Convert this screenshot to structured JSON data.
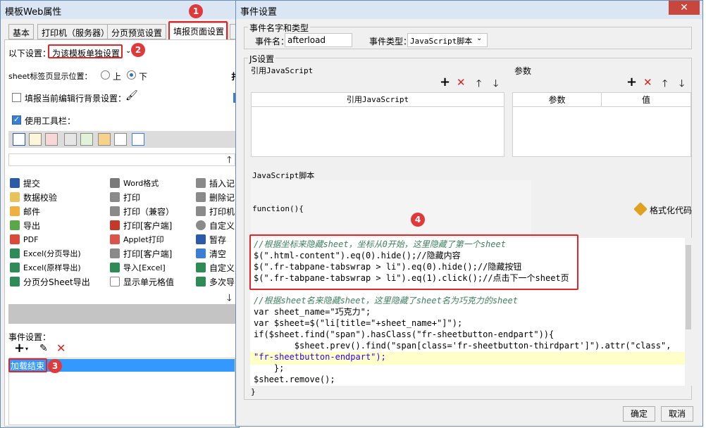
{
  "left_window": {
    "title": "模板Web属性",
    "tabs": [
      "基本",
      "打印机（服务器）",
      "分页预览设置",
      "填报页面设置"
    ],
    "settings_label": "以下设置：",
    "settings_value": "为该模板单独设置",
    "sheet_tab_label": "sheet标签页显示位置：",
    "radio_top": "上",
    "radio_bottom": "下",
    "bg_label": "填报当前编辑行背景设置：",
    "toolbar_label": "使用工具栏：",
    "items_col1": [
      "提交",
      "数据校验",
      "邮件",
      "导出",
      "PDF",
      "Excel(分页导出)",
      "Excel(原样导出)",
      "分页分Sheet导出"
    ],
    "items_col2": [
      "Word格式",
      "打印",
      "打印（兼容）",
      "打印[客户端]",
      "Applet打印",
      "打印[客户端]",
      "导入[Excel]",
      "显示单元格值"
    ],
    "items_col3": [
      "插入记",
      "删除记",
      "打印机",
      "自定义",
      "暂存",
      "清空",
      "自定义",
      "多次导"
    ],
    "event_label": "事件设置：",
    "event_item": "加载结束"
  },
  "dialog": {
    "title": "事件设置",
    "group_name_type": "事件名字和类型",
    "event_name_label": "事件名：",
    "event_name_value": "afterload",
    "event_type_label": "事件类型：",
    "event_type_value": "JavaScript脚本",
    "js_settings": "JS设置",
    "ref_js_label": "引用JavaScript",
    "params_label": "参数",
    "ref_js_header": "引用JavaScript",
    "param_header": "参数",
    "value_header": "值",
    "script_label": "JavaScript脚本",
    "function_open": "function(){",
    "format_code": "格式化代码",
    "function_close": "}",
    "ok": "确定",
    "cancel": "取消"
  },
  "code_lines": [
    "//根据坐标来隐藏sheet，坐标从0开始，这里隐藏了第一个sheet",
    "$(\".html-content\").eq(0).hide();//隐藏内容",
    "$(\".fr-tabpane-tabswrap > li\").eq(0).hide();//隐藏按钮",
    "$(\".fr-tabpane-tabswrap > li\").eq(1).click();//点击下一个sheet页",
    "",
    "//根据sheet名来隐藏sheet，这里隐藏了sheet名为巧克力的sheet",
    "var sheet_name=\"巧克力\";",
    "var $sheet=$(\"li[title=\"+sheet_name+\"]\");",
    "if($sheet.find(\"span\").hasClass(\"fr-sheetbutton-endpart\")){",
    "        $sheet.prev().find(\"span[class='fr-sheetbutton-thirdpart']\").attr(\"class\",",
    "\"fr-sheetbutton-endpart\");",
    "    };",
    "$sheet.remove();"
  ],
  "badges": [
    "1",
    "2",
    "3",
    "4"
  ],
  "colors": {
    "accent_red": "#e0262a",
    "selection_blue": "#3399ff",
    "code_comment": "#3f7f5f",
    "code_keyword": "#0000ff"
  }
}
